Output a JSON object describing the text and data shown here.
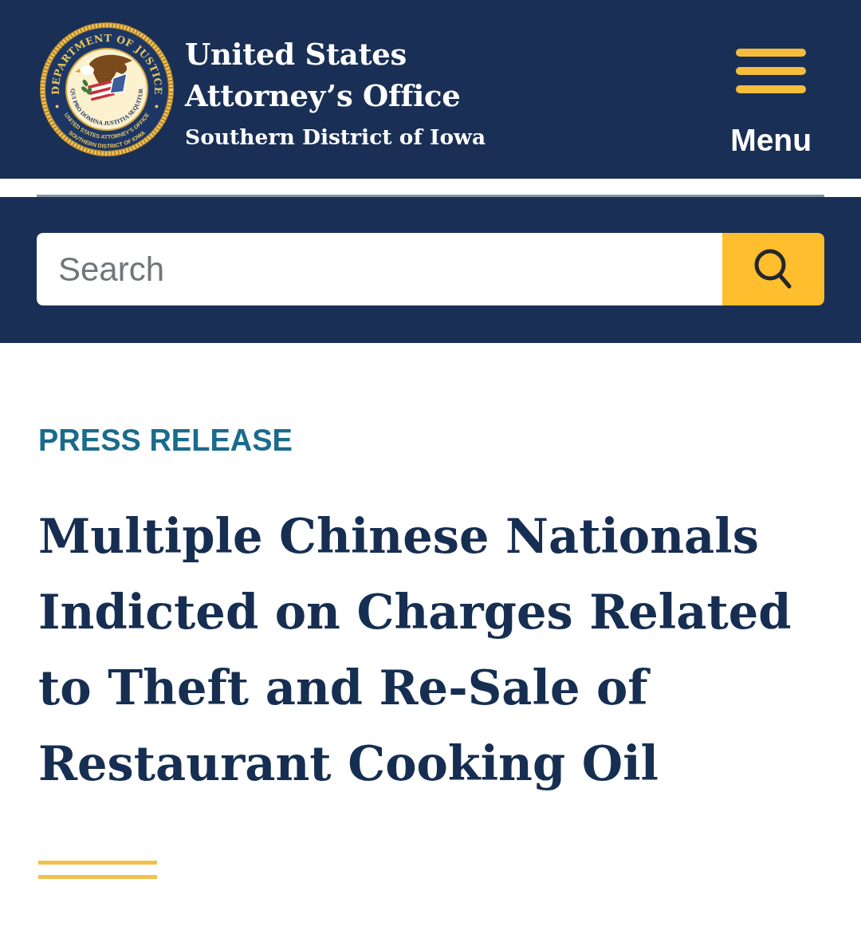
{
  "header": {
    "seal": {
      "ring_text": "DEPARTMENT OF JUSTICE",
      "motto": "QUI PRO DOMINA JUSTITIA SEQUITUR",
      "lower_ring_text": [
        "UNITED STATES ATTORNEY'S OFFICE",
        "SOUTHERN DISTRICT OF IOWA"
      ]
    },
    "site_title": "United States Attorney’s Office",
    "site_subtitle": "Southern District of Iowa",
    "menu_button": {
      "label": "Menu"
    }
  },
  "search": {
    "placeholder": "Search"
  },
  "article": {
    "category": "PRESS RELEASE",
    "title": "Multiple Chinese Nationals Indicted on Charges Related to Theft and Re-Sale of Restaurant Cooking Oil"
  }
}
